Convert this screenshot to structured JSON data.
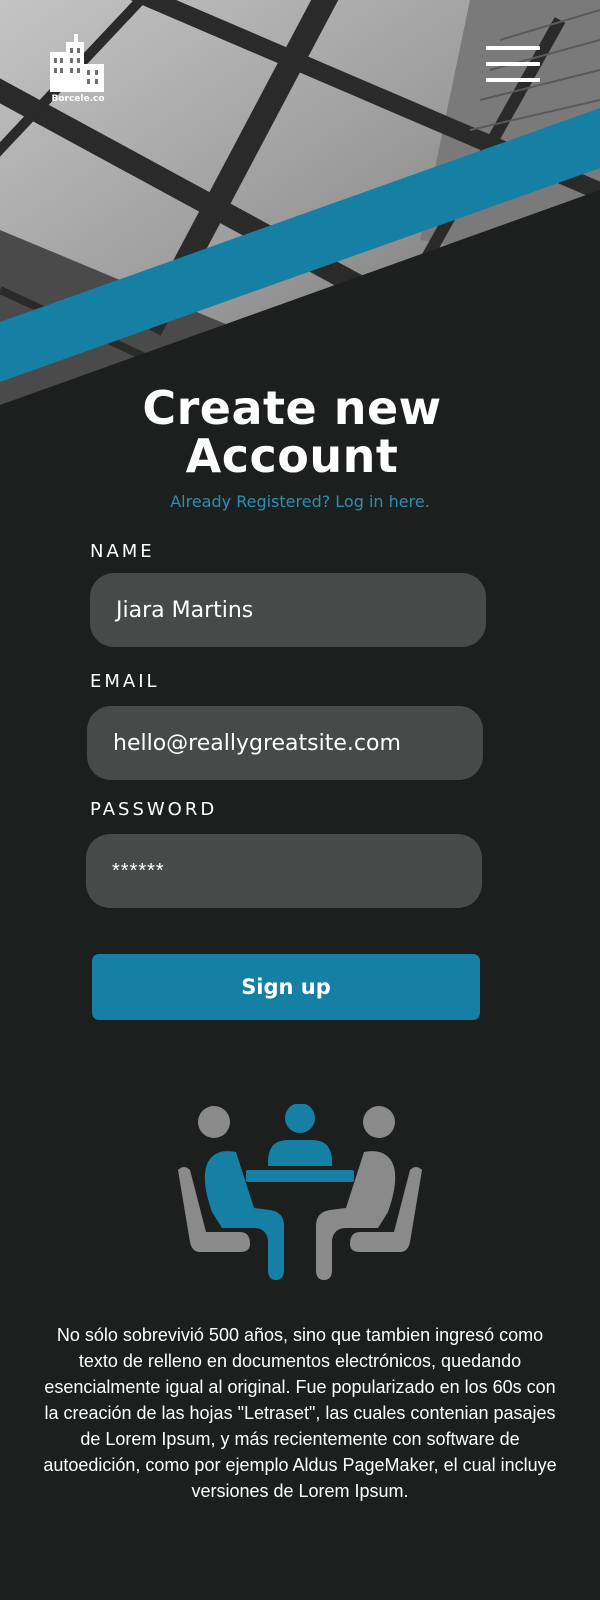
{
  "header": {
    "logo_text": "Borcele.co",
    "logo_icon": "building-icon",
    "menu_icon": "hamburger-menu-icon"
  },
  "form": {
    "title_line1": "Create new",
    "title_line2": "Account",
    "login_link": "Already Registered? Log in here.",
    "name_label": "NAME",
    "name_value": "Jiara Martins",
    "email_label": "EMAIL",
    "email_value": "hello@reallygreatsite.com",
    "password_label": "PASSWORD",
    "password_value": "******",
    "signup_label": "Sign up"
  },
  "illustration": {
    "icon": "meeting-icon"
  },
  "footer": {
    "body": "No sólo sobrevivió 500 años, sino que tambien ingresó como texto de relleno en documentos electrónicos, quedando esencialmente igual al original. Fue popularizado en los 60s con la creación de las hojas \"Letraset\", las cuales contenian pasajes de Lorem Ipsum, y más recientemente con software de autoedición, como por ejemplo Aldus PageMaker, el cual incluye versiones de Lorem Ipsum."
  },
  "colors": {
    "background": "#1d1f1f",
    "accent": "#1580a3",
    "link": "#2c8fb2",
    "field": "#484a4a",
    "icon_gray": "#8a8a8a"
  }
}
